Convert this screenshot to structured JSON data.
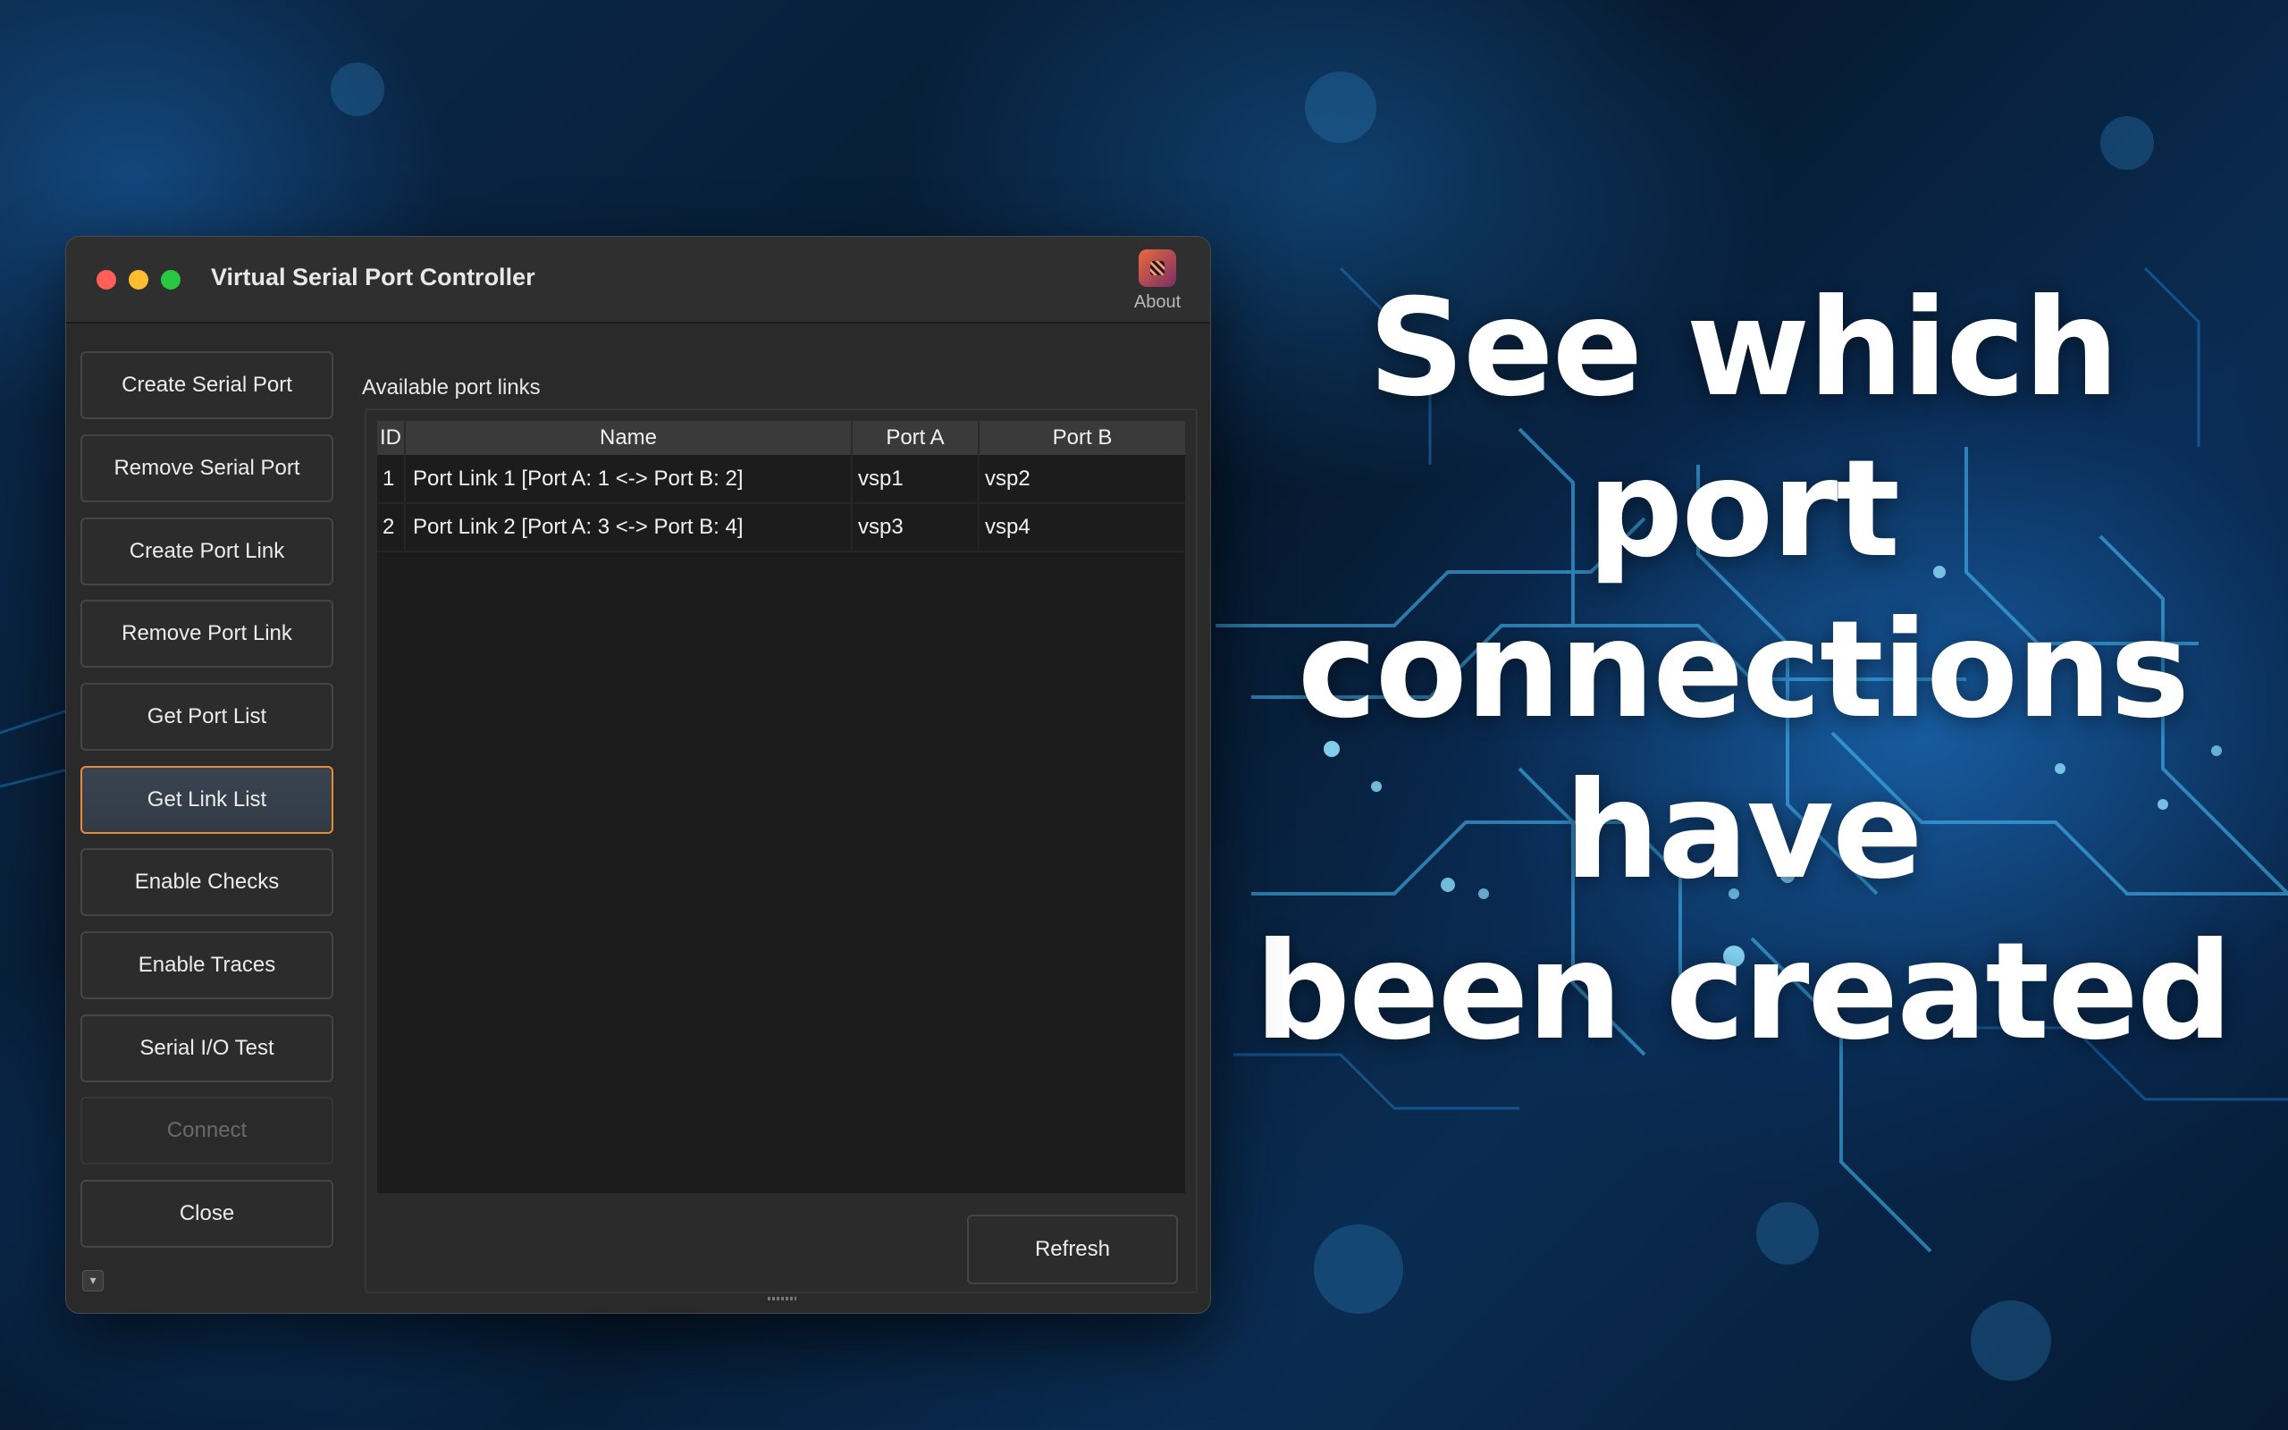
{
  "headline": {
    "line1": "See which port",
    "line2": "connections have",
    "line3": "been created"
  },
  "window": {
    "title": "Virtual Serial Port Controller",
    "about_label": "About",
    "about_icon": "app-logo-icon"
  },
  "sidebar": {
    "buttons": [
      {
        "label": "Create Serial Port",
        "state": "normal"
      },
      {
        "label": "Remove Serial Port",
        "state": "normal"
      },
      {
        "label": "Create Port Link",
        "state": "normal"
      },
      {
        "label": "Remove Port Link",
        "state": "normal"
      },
      {
        "label": "Get Port List",
        "state": "normal"
      },
      {
        "label": "Get Link List",
        "state": "active"
      },
      {
        "label": "Enable Checks",
        "state": "normal"
      },
      {
        "label": "Enable Traces",
        "state": "normal"
      },
      {
        "label": "Serial I/O Test",
        "state": "normal"
      },
      {
        "label": "Connect",
        "state": "disabled"
      },
      {
        "label": "Close",
        "state": "normal"
      }
    ]
  },
  "main": {
    "section_label": "Available port links",
    "table": {
      "columns": [
        "ID",
        "Name",
        "Port A",
        "Port B"
      ],
      "rows": [
        {
          "id": "1",
          "name": "Port Link 1 [Port A: 1 <-> Port B: 2]",
          "port_a": "vsp1",
          "port_b": "vsp2"
        },
        {
          "id": "2",
          "name": "Port Link 2 [Port A: 3 <-> Port B: 4]",
          "port_a": "vsp3",
          "port_b": "vsp4"
        }
      ]
    },
    "refresh_label": "Refresh"
  },
  "colors": {
    "accent_focus": "#e88a3a",
    "window_bg": "#2a2a2a",
    "table_bg": "#1c1c1c"
  }
}
